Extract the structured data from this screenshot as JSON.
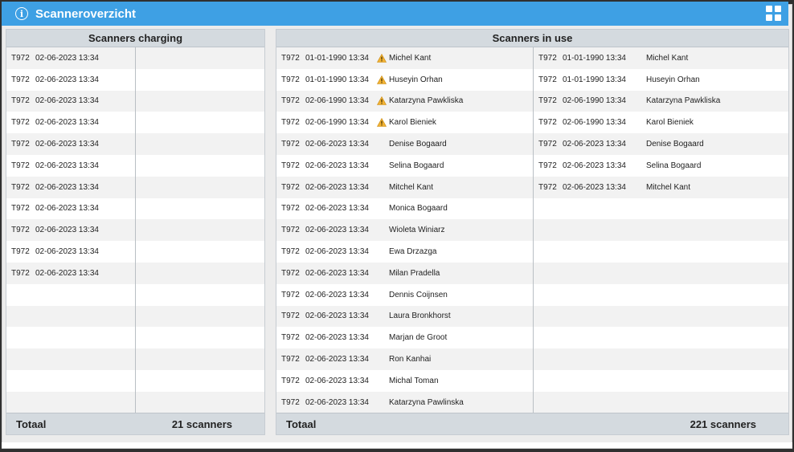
{
  "window": {
    "title": "Scanneroverzicht"
  },
  "charging": {
    "header": "Scanners charging",
    "footer_label": "Totaal",
    "footer_count": "21 scanners",
    "rows": [
      {
        "id": "T972",
        "date": "02-06-2023 13:34"
      },
      {
        "id": "T972",
        "date": "02-06-2023 13:34"
      },
      {
        "id": "T972",
        "date": "02-06-2023 13:34"
      },
      {
        "id": "T972",
        "date": "02-06-2023 13:34"
      },
      {
        "id": "T972",
        "date": "02-06-2023 13:34"
      },
      {
        "id": "T972",
        "date": "02-06-2023 13:34"
      },
      {
        "id": "T972",
        "date": "02-06-2023 13:34"
      },
      {
        "id": "T972",
        "date": "02-06-2023 13:34"
      },
      {
        "id": "T972",
        "date": "02-06-2023 13:34"
      },
      {
        "id": "T972",
        "date": "02-06-2023 13:34"
      },
      {
        "id": "T972",
        "date": "02-06-2023 13:34"
      }
    ]
  },
  "in_use": {
    "header": "Scanners in use",
    "footer_label": "Totaal",
    "footer_count": "221 scanners",
    "col1": [
      {
        "id": "T972",
        "date": "01-01-1990 13:34",
        "warn": true,
        "name": "Michel Kant"
      },
      {
        "id": "T972",
        "date": "01-01-1990 13:34",
        "warn": true,
        "name": "Huseyin Orhan"
      },
      {
        "id": "T972",
        "date": "02-06-1990 13:34",
        "warn": true,
        "name": "Katarzyna Pawkliska"
      },
      {
        "id": "T972",
        "date": "02-06-1990 13:34",
        "warn": true,
        "name": "Karol Bieniek"
      },
      {
        "id": "T972",
        "date": "02-06-2023 13:34",
        "warn": false,
        "name": "Denise Bogaard"
      },
      {
        "id": "T972",
        "date": "02-06-2023 13:34",
        "warn": false,
        "name": "Selina Bogaard"
      },
      {
        "id": "T972",
        "date": "02-06-2023 13:34",
        "warn": false,
        "name": "Mitchel Kant"
      },
      {
        "id": "T972",
        "date": "02-06-2023 13:34",
        "warn": false,
        "name": "Monica Bogaard"
      },
      {
        "id": "T972",
        "date": "02-06-2023 13:34",
        "warn": false,
        "name": "Wioleta Winiarz"
      },
      {
        "id": "T972",
        "date": "02-06-2023 13:34",
        "warn": false,
        "name": "Ewa Drzazga"
      },
      {
        "id": "T972",
        "date": "02-06-2023 13:34",
        "warn": false,
        "name": "Milan Pradella"
      },
      {
        "id": "T972",
        "date": "02-06-2023 13:34",
        "warn": false,
        "name": "Dennis Coijnsen"
      },
      {
        "id": "T972",
        "date": "02-06-2023 13:34",
        "warn": false,
        "name": "Laura Bronkhorst"
      },
      {
        "id": "T972",
        "date": "02-06-2023 13:34",
        "warn": false,
        "name": "Marjan de Groot"
      },
      {
        "id": "T972",
        "date": "02-06-2023 13:34",
        "warn": false,
        "name": "Ron Kanhai"
      },
      {
        "id": "T972",
        "date": "02-06-2023 13:34",
        "warn": false,
        "name": "Michal Toman"
      },
      {
        "id": "T972",
        "date": "02-06-2023 13:34",
        "warn": false,
        "name": "Katarzyna Pawlinska"
      }
    ],
    "col2": [
      {
        "id": "T972",
        "date": "01-01-1990 13:34",
        "name": "Michel Kant"
      },
      {
        "id": "T972",
        "date": "01-01-1990 13:34",
        "name": "Huseyin Orhan"
      },
      {
        "id": "T972",
        "date": "02-06-1990 13:34",
        "name": "Katarzyna Pawkliska"
      },
      {
        "id": "T972",
        "date": "02-06-1990 13:34",
        "name": "Karol Bieniek"
      },
      {
        "id": "T972",
        "date": "02-06-2023 13:34",
        "name": "Denise Bogaard"
      },
      {
        "id": "T972",
        "date": "02-06-2023 13:34",
        "name": "Selina Bogaard"
      },
      {
        "id": "T972",
        "date": "02-06-2023 13:34",
        "name": "Mitchel Kant"
      }
    ]
  },
  "colors": {
    "titlebar": "#3ea0e4",
    "warning": "#f2b233",
    "header_bg": "#d4dadf"
  }
}
